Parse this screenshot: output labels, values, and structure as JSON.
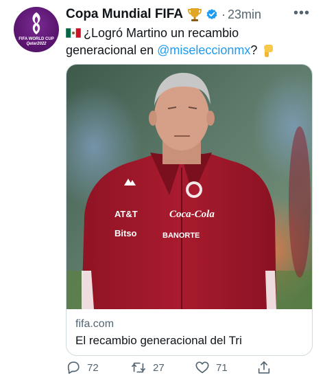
{
  "account": {
    "name": "Copa Mundial FIFA",
    "time_separator": "·",
    "time": "23min",
    "more_icon": "more-horizontal-icon",
    "avatar": {
      "line1": "FIFA WORLD CUP",
      "line2": "Qatar2022"
    }
  },
  "tweet": {
    "text_part1": "¿Logró Martino un recambio generacional en ",
    "mention": "@misel​eccionmx",
    "text_part2": "?"
  },
  "card": {
    "domain": "fifa.com",
    "title": "El recambio generacional del Tri",
    "jacket_texts": [
      "AT&T",
      "Coca-Cola",
      "Bitso",
      "BANORTE"
    ]
  },
  "actions": {
    "replies": "72",
    "retweets": "27",
    "likes": "71"
  },
  "colors": {
    "link": "#1d9bf0",
    "secondary_text": "#536471",
    "jacket": "#a2172b"
  }
}
